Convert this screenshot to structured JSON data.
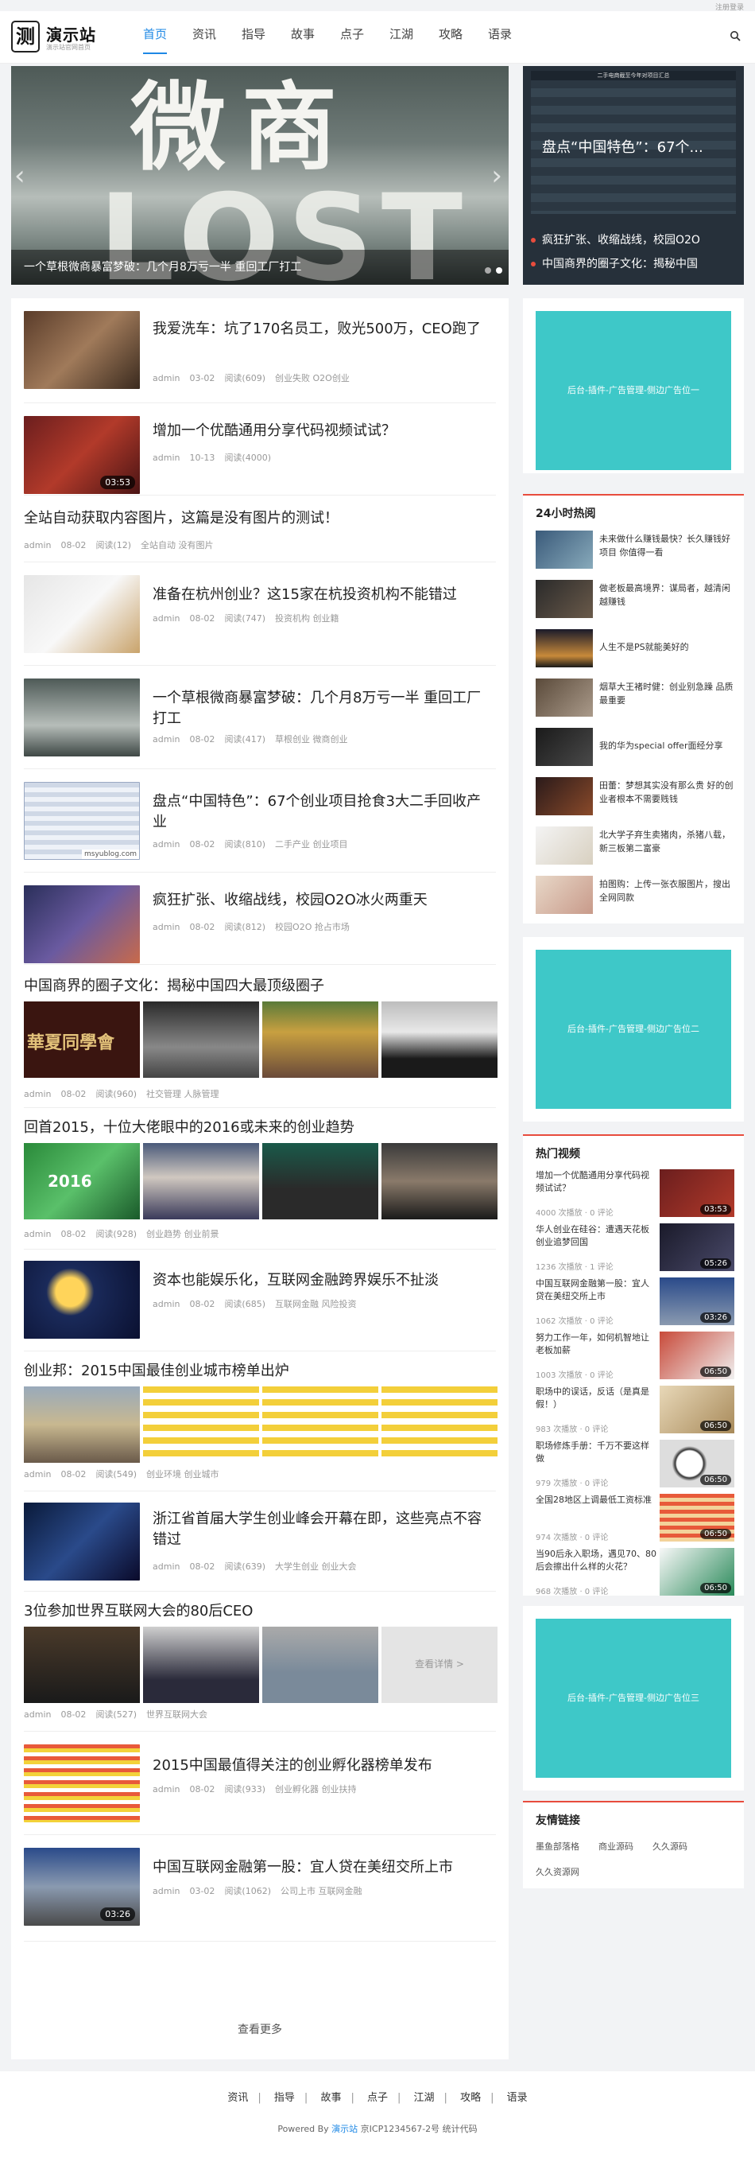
{
  "topbar": {
    "login": "注册登录"
  },
  "header": {
    "logo_mark": "测",
    "logo_name": "演示站",
    "logo_slogan": "演示站官网首页",
    "nav": [
      "首页",
      "资讯",
      "指导",
      "故事",
      "点子",
      "江湖",
      "攻略",
      "语录"
    ]
  },
  "slider": {
    "big1": "微商",
    "big2": "LOST",
    "caption": "一个草根微商暴富梦破：几个月8万亏一半 重回工厂打工",
    "arrow_left": "‹",
    "arrow_right": "›"
  },
  "headline": {
    "table_title": "二手电商截至今年对项目汇总",
    "title": "盘点“中国特色”：67个...",
    "items": [
      "疯狂扩张、收缩战线，校园O2O",
      "中国商界的圈子文化：揭秘中国"
    ]
  },
  "articles": [
    {
      "title": "我爱洗车：坑了170名员工，败光500万，CEO跑了",
      "author": "admin",
      "date": "03-02",
      "views": "阅读(609)",
      "tags": "创业失败 O2O创业"
    },
    {
      "title": "增加一个优酷通用分享代码视频试试？",
      "author": "admin",
      "date": "10-13",
      "views": "阅读(4000)",
      "tags": "",
      "duration": "03:53"
    },
    {
      "title": "全站自动获取内容图片，这篇是没有图片的测试！",
      "author": "admin",
      "date": "08-02",
      "views": "阅读(12)",
      "tags": "全站自动 没有图片"
    },
    {
      "title": "准备在杭州创业？这15家在杭投资机构不能错过",
      "author": "admin",
      "date": "08-02",
      "views": "阅读(747)",
      "tags": "投资机构 创业籍"
    },
    {
      "title": "一个草根微商暴富梦破：几个月8万亏一半 重回工厂打工",
      "author": "admin",
      "date": "08-02",
      "views": "阅读(417)",
      "tags": "草根创业 微商创业"
    },
    {
      "title": "盘点“中国特色”：67个创业项目抢食3大二手回收产业",
      "author": "admin",
      "date": "08-02",
      "views": "阅读(810)",
      "tags": "二手产业 创业项目",
      "watermark": "msyublog.com"
    },
    {
      "title": "疯狂扩张、收缩战线，校园O2O冰火两重天",
      "author": "admin",
      "date": "08-02",
      "views": "阅读(812)",
      "tags": "校园O2O 抢占市场"
    },
    {
      "title": "中国商界的圈子文化：揭秘中国四大最顶级圈子",
      "author": "admin",
      "date": "08-02",
      "views": "阅读(960)",
      "tags": "社交管理 人脉管理",
      "img1_text": "華夏同學會"
    },
    {
      "title": "回首2015，十位大佬眼中的2016或未来的创业趋势",
      "author": "admin",
      "date": "08-02",
      "views": "阅读(928)",
      "tags": "创业趋势 创业前景",
      "img1_text": "2016"
    },
    {
      "title": "资本也能娱乐化，互联网金融跨界娱乐不扯淡",
      "author": "admin",
      "date": "08-02",
      "views": "阅读(685)",
      "tags": "互联网金融 风险投资"
    },
    {
      "title": "创业邦：2015中国最佳创业城市榜单出炉",
      "author": "admin",
      "date": "08-02",
      "views": "阅读(549)",
      "tags": "创业环境 创业城市"
    },
    {
      "title": "浙江省首届大学生创业峰会开幕在即，这些亮点不容错过",
      "author": "admin",
      "date": "08-02",
      "views": "阅读(639)",
      "tags": "大学生创业 创业大会"
    },
    {
      "title": "3位参加世界互联网大会的80后CEO",
      "author": "admin",
      "date": "08-02",
      "views": "阅读(527)",
      "tags": "世界互联网大会",
      "more_label": "查看详情 >"
    },
    {
      "title": "2015中国最值得关注的创业孵化器榜单发布",
      "author": "admin",
      "date": "08-02",
      "views": "阅读(933)",
      "tags": "创业孵化器 创业扶持"
    },
    {
      "title": "中国互联网金融第一股：宜人贷在美纽交所上市",
      "author": "admin",
      "date": "03-02",
      "views": "阅读(1062)",
      "tags": "公司上市 互联网金融",
      "duration": "03:26"
    }
  ],
  "load_more": "查看更多",
  "sidebar": {
    "ad1": "后台-插件-广告管理-侧边广告位一",
    "ad2": "后台-插件-广告管理-侧边广告位二",
    "ad3": "后台-插件-广告管理-侧边广告位三",
    "hot_title": "24小时热阅",
    "hot": [
      "未来做什么赚钱最快？长久赚钱好项目 你值得一看",
      "做老板最高境界：谋局者，越清闲越赚钱",
      "人生不是PS就能美好的",
      "烟草大王褚时健：创业别急躁 品质最重要",
      "我的华为special offer面经分享",
      "田蕾：梦想其实没有那么贵 好的创业者根本不需要贱钱",
      "北大学子弃生卖猪肉，杀猪八载，新三板第二富豪",
      "拍图购：上传一张衣服图片，搜出全网同款"
    ],
    "video_title": "热门视频",
    "videos": [
      {
        "t": "增加一个优酷通用分享代码视频试试？",
        "m": "4000 次播放 · 0 评论",
        "d": "03:53"
      },
      {
        "t": "华人创业在硅谷：遭遇天花板 创业追梦回国",
        "m": "1236 次播放 · 1 评论",
        "d": "05:26"
      },
      {
        "t": "中国互联网金融第一股：宜人贷在美纽交所上市",
        "m": "1062 次播放 · 0 评论",
        "d": "03:26"
      },
      {
        "t": "努力工作一年，如何机智地让老板加薪",
        "m": "1003 次播放 · 0 评论",
        "d": "06:50"
      },
      {
        "t": "职场中的误话，反话（是真是假！）",
        "m": "983 次播放 · 0 评论",
        "d": "06:50"
      },
      {
        "t": "职场修炼手册：千万不要这样做",
        "m": "979 次播放 · 0 评论",
        "d": "06:50"
      },
      {
        "t": "全国28地区上调最低工资标准",
        "m": "974 次播放 · 0 评论",
        "d": "06:50"
      },
      {
        "t": "当90后永入职场，遇见70、80后会擦出什么样的火花？",
        "m": "968 次播放 · 0 评论",
        "d": "06:50"
      }
    ],
    "links_title": "友情链接",
    "links": [
      "墨鱼部落格",
      "商业源码",
      "久久源码",
      "久久资源网"
    ]
  },
  "footer": {
    "nav": [
      "资讯",
      "指导",
      "故事",
      "点子",
      "江湖",
      "攻略",
      "语录"
    ],
    "sep": "|",
    "powered": "Powered By",
    "site": "演示站",
    "icp": "京ICP1234567-2号 统计代码"
  }
}
